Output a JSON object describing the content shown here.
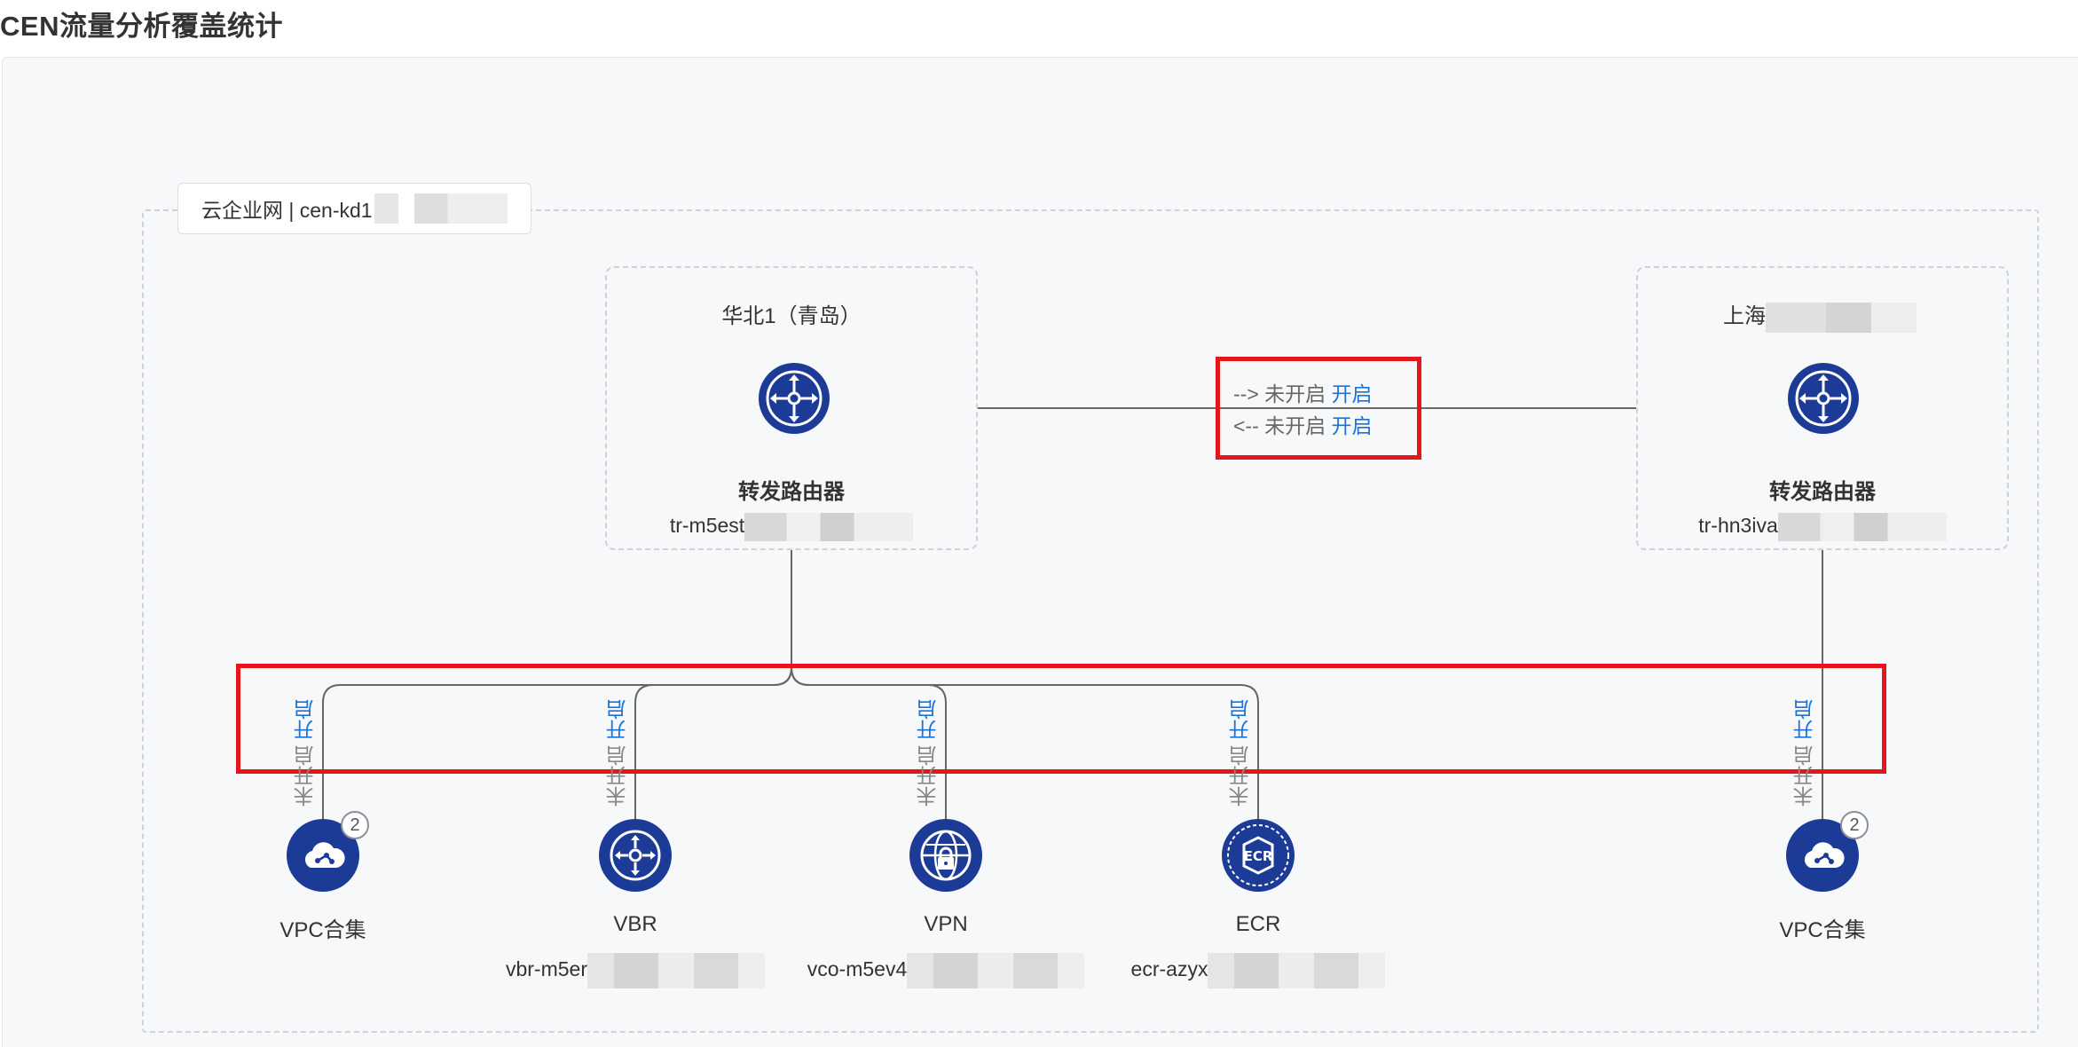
{
  "page": {
    "title": "CEN流量分析覆盖统计"
  },
  "cen": {
    "label": "云企业网 | cen-kd1"
  },
  "regions": [
    {
      "name": "华北1（青岛）",
      "type": "转发路由器",
      "id": "tr-m5est"
    },
    {
      "name": "上海",
      "type": "转发路由器",
      "id": "tr-hn3iva"
    }
  ],
  "peer": {
    "out": {
      "arrow": "-->",
      "status": "未开启",
      "action": "开启"
    },
    "in": {
      "arrow": "<--",
      "status": "未开启",
      "action": "开启"
    }
  },
  "attachments": [
    {
      "type": "VPC合集",
      "id": "",
      "badge": "2",
      "status": "未开启",
      "action": "开启",
      "icon": "cloud-network-icon"
    },
    {
      "type": "VBR",
      "id": "vbr-m5er",
      "badge": "",
      "status": "未开启",
      "action": "开启",
      "icon": "router-icon"
    },
    {
      "type": "VPN",
      "id": "vco-m5ev4",
      "badge": "",
      "status": "未开启",
      "action": "开启",
      "icon": "globe-lock-icon"
    },
    {
      "type": "ECR",
      "id": "ecr-azyx",
      "badge": "",
      "status": "未开启",
      "action": "开启",
      "icon": "ecr-icon"
    },
    {
      "type": "VPC合集",
      "id": "",
      "badge": "2",
      "status": "未开启",
      "action": "开启",
      "icon": "cloud-network-icon"
    }
  ],
  "colors": {
    "brand": "#1c3b96",
    "link": "#1a73d9",
    "highlight": "#e5161b"
  }
}
